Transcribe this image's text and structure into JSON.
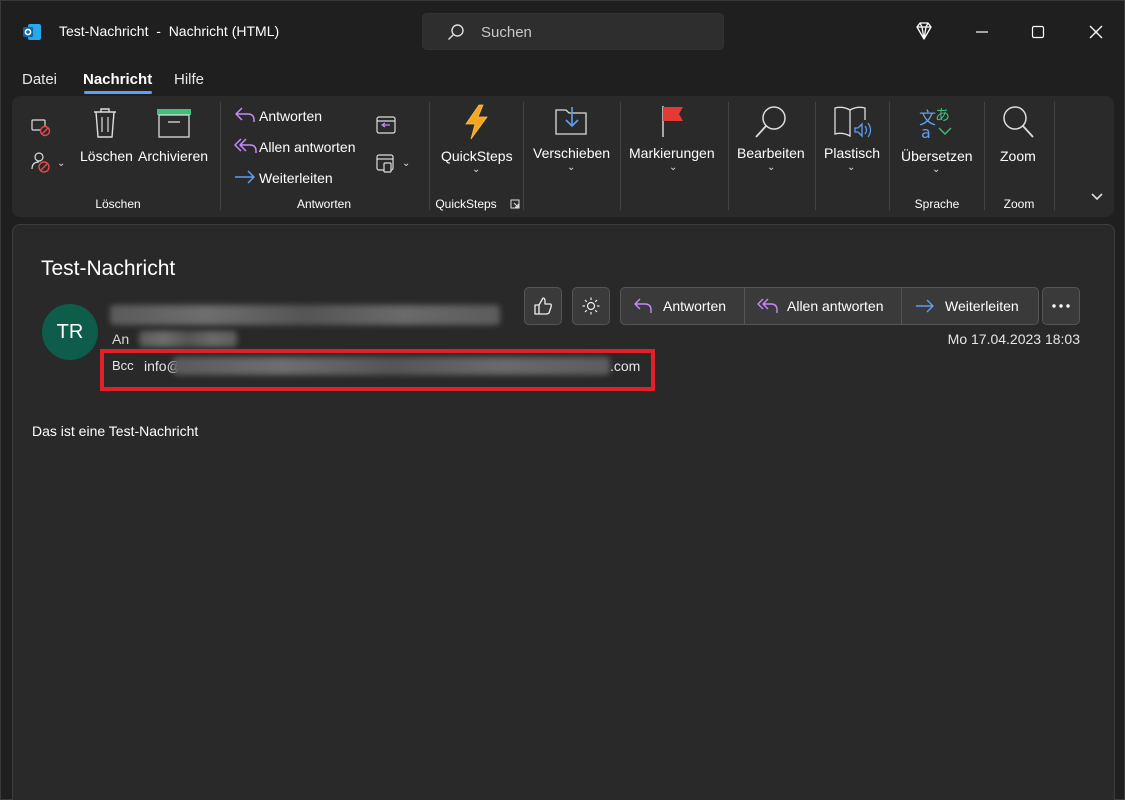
{
  "window": {
    "title": "Test-Nachricht  -  Nachricht (HTML)",
    "search_placeholder": "Suchen"
  },
  "tabs": [
    {
      "label": "Datei",
      "active": false
    },
    {
      "label": "Nachricht",
      "active": true
    },
    {
      "label": "Hilfe",
      "active": false
    }
  ],
  "ribbon": {
    "groups": {
      "loeschen": "Löschen",
      "antworten": "Antworten",
      "quicksteps": "QuickSteps",
      "sprache": "Sprache",
      "zoom": "Zoom"
    },
    "buttons": {
      "loeschen": "Löschen",
      "archivieren": "Archivieren",
      "antworten": "Antworten",
      "allen_antworten": "Allen antworten",
      "weiterleiten": "Weiterleiten",
      "quicksteps": "QuickSteps",
      "verschieben": "Verschieben",
      "markierungen": "Markierungen",
      "bearbeiten": "Bearbeiten",
      "plastisch": "Plastisch",
      "uebersetzen": "Übersetzen",
      "zoom": "Zoom"
    }
  },
  "message": {
    "subject": "Test-Nachricht",
    "avatar_initials": "TR",
    "to_label": "An",
    "bcc_label": "Bcc",
    "bcc_visible_start": "info@",
    "bcc_visible_end": ".com",
    "date": "Mo 17.04.2023 18:03",
    "actions": {
      "reply": "Antworten",
      "reply_all": "Allen antworten",
      "forward": "Weiterleiten"
    },
    "body": "Das ist eine Test-Nachricht"
  },
  "colors": {
    "accent": "#5ea0ef",
    "reply_purple": "#c58af9",
    "forward_blue": "#5ea0ef",
    "highlight_red": "#e3202a",
    "avatar_green": "#0e5c4a"
  }
}
